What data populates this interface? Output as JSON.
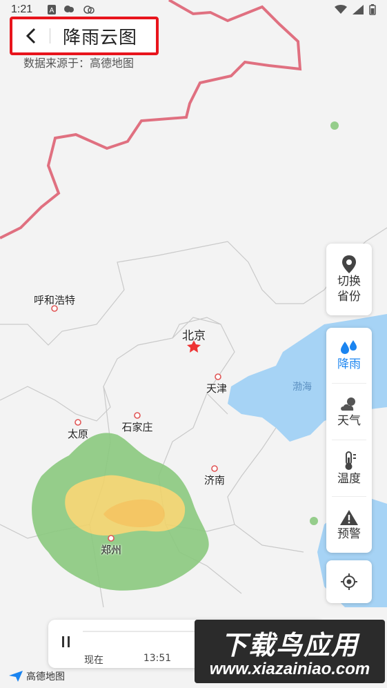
{
  "status": {
    "time": "1:21"
  },
  "header": {
    "title": "降雨云图",
    "source_note": "数据来源于：高德地图"
  },
  "cities": {
    "hohhot": "呼和浩特",
    "beijing": "北京",
    "tianjin": "天津",
    "taiyuan": "太原",
    "shijiazhuang": "石家庄",
    "jinan": "济南",
    "zhengzhou": "郑州"
  },
  "sea": {
    "bohai": "渤海"
  },
  "side_panel": {
    "switch_province": "切换\n省份",
    "rain": "降雨",
    "weather": "天气",
    "temperature": "温度",
    "warning": "预警"
  },
  "timeline": {
    "now_label": "现在",
    "time_label": "13:51"
  },
  "map_brand": "高德地图",
  "watermark": {
    "title": "下载鸟应用",
    "url": "www.xiazainiao.com"
  },
  "colors": {
    "accent": "#1a84f0",
    "border_line": "#e07070",
    "sea": "#9fd0f5",
    "rain_light": "#84c97c",
    "rain_heavy": "#f2d26a",
    "highlight": "#e8141c"
  }
}
